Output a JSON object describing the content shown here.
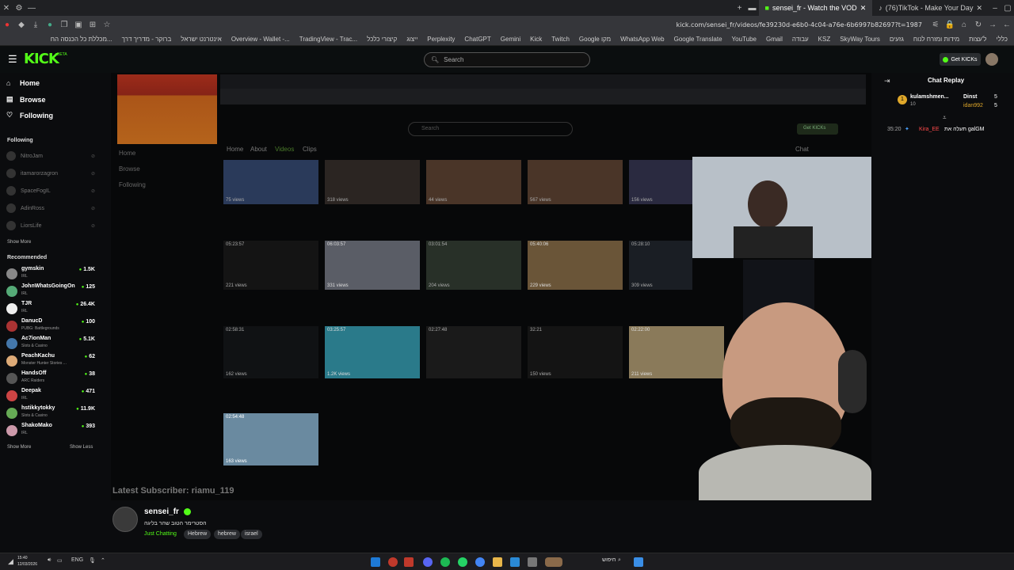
{
  "browser": {
    "tabs": [
      {
        "label": "sensei_fr - Watch the VOD",
        "active": true
      },
      {
        "label": "(76)TikTok - Make Your Day",
        "active": false
      }
    ],
    "url": "kick.com/sensei_fr/videos/fe39230d-e6b0-4c04-a76e-6b6997b82697?t=1987",
    "bookmarks": [
      "כללי",
      "ל'עצות",
      "מידות ומזרח לנוח",
      "גזעים",
      "SkyWay Tours",
      "KSZ",
      "עבודה",
      "Gmail",
      "YouTube",
      "Google Translate",
      "WhatsApp Web",
      "Google מקו",
      "Twitch",
      "Kick",
      "Gemini",
      "ChatGPT",
      "Perplexity",
      "ייצוג",
      "קיצורי כלכל",
      "TradingView - Trac...",
      "Overview - Wallet -...",
      "אינטרנט ישראל",
      "ברוקר - מדריך דרך",
      "מכללת כל הכנסה הח..."
    ]
  },
  "header": {
    "logo": "KICK",
    "beta": "BETA",
    "search_placeholder": "Search",
    "get_kicks": "Get KICKs"
  },
  "sidebar": {
    "nav": [
      {
        "label": "Home",
        "icon": "home-icon"
      },
      {
        "label": "Browse",
        "icon": "browse-icon"
      },
      {
        "label": "Following",
        "icon": "heart-icon"
      }
    ],
    "following_title": "Following",
    "following": [
      "NitroJam",
      "itamarorzagron",
      "SpaceFogIL",
      "AdinRoss",
      "LiorsLife"
    ],
    "show_more": "Show More",
    "recommended_title": "Recommended",
    "recommended": [
      {
        "name": "gymskin",
        "category": "IRL",
        "viewers": "1.5K",
        "color": "#888"
      },
      {
        "name": "JohnWhatsGoingOn",
        "category": "IRL",
        "viewers": "125",
        "color": "#5a7"
      },
      {
        "name": "TJR",
        "category": "IRL",
        "viewers": "26.4K",
        "color": "#eee"
      },
      {
        "name": "DanucD",
        "category": "PUBG: Battlegrounds",
        "viewers": "100",
        "color": "#a33"
      },
      {
        "name": "Ac7ionMan",
        "category": "Slots & Casino",
        "viewers": "5.1K",
        "color": "#47a"
      },
      {
        "name": "PeachKachu",
        "category": "Monster Hunter Stories ...",
        "viewers": "62",
        "color": "#da7"
      },
      {
        "name": "HandsOff",
        "category": "ARC Raiders",
        "viewers": "38",
        "color": "#555"
      },
      {
        "name": "Deepak",
        "category": "IRL",
        "viewers": "471",
        "color": "#c44"
      },
      {
        "name": "hstikkytokky",
        "category": "Slots & Casino",
        "viewers": "11.9K",
        "color": "#6a5"
      },
      {
        "name": "ShakoMako",
        "category": "IRL",
        "viewers": "393",
        "color": "#c9a"
      }
    ],
    "show_more_2": "Show More",
    "show_less": "Show Less"
  },
  "video": {
    "inner_tabs": [
      "Home",
      "About",
      "Videos",
      "Clips"
    ],
    "inner_nav": [
      "Home",
      "Browse",
      "Following"
    ],
    "inner_search": "Search",
    "inner_get_kicks": "Get KICKs",
    "inner_chat": "Chat",
    "latest_subscriber": "Latest Subscriber: riamu_119",
    "thumbs": [
      {
        "dur": "",
        "views": "75 views"
      },
      {
        "dur": "",
        "views": "318 views"
      },
      {
        "dur": "",
        "views": "44 views"
      },
      {
        "dur": "",
        "views": "567 views"
      },
      {
        "dur": "",
        "views": "156 views"
      },
      {
        "dur": "05:23:57",
        "views": "221 views"
      },
      {
        "dur": "06:03:57",
        "views": "331 views"
      },
      {
        "dur": "03:01:54",
        "views": "204 views"
      },
      {
        "dur": "05:40:06",
        "views": "229 views"
      },
      {
        "dur": "05:28:10",
        "views": "309 views"
      },
      {
        "dur": "02:58:31",
        "views": "162 views"
      },
      {
        "dur": "03:25:57",
        "views": "1.2K views"
      },
      {
        "dur": "02:27:48",
        "views": ""
      },
      {
        "dur": "32:21",
        "views": "150 views"
      },
      {
        "dur": "02:22:00",
        "views": "211 views"
      },
      {
        "dur": "02:54:48",
        "views": "163 views"
      }
    ]
  },
  "chat": {
    "title": "Chat Replay",
    "top_gifters": [
      {
        "name": "kulamshmen...",
        "count": "10",
        "rank": "1"
      },
      {
        "name": "Dinst",
        "count": "5",
        "rank": ""
      },
      {
        "name": "idan992",
        "count": "5",
        "rank": ""
      }
    ],
    "message": {
      "time": "35:20",
      "user": "Kira_EE",
      "text": "תעלה את galGM"
    }
  },
  "stream": {
    "name": "sensei_fr",
    "title": "הסטרימר הטוב שהר בליגה",
    "category": "Just Chatting",
    "tags": [
      "Hebrew",
      "hebrew",
      "israel"
    ]
  },
  "taskbar": {
    "time": "15:40",
    "date": "12/03/2026",
    "lang": "ENG",
    "search": "חיפוש"
  }
}
